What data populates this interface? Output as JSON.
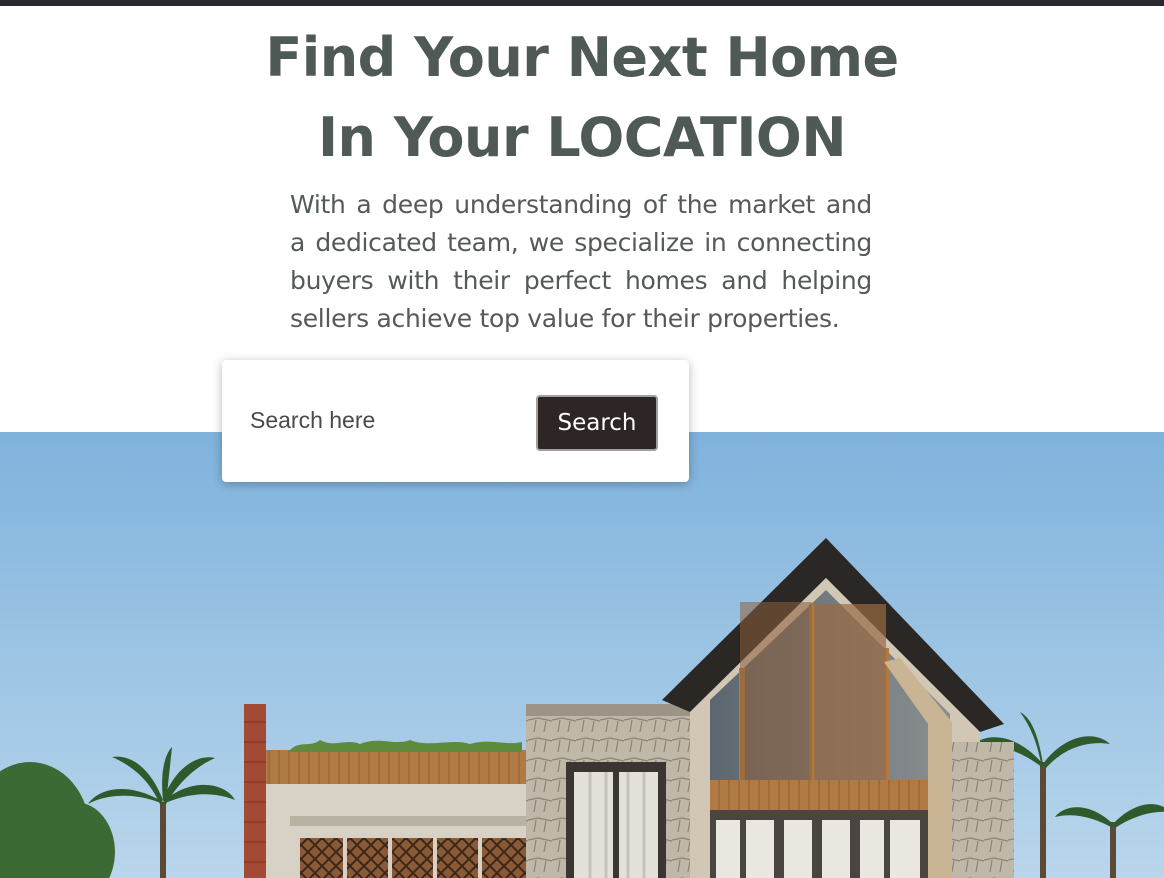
{
  "hero": {
    "title_line1": "Find Your Next Home",
    "title_line2": "In Your LOCATION",
    "description": "With a deep understanding of the market and a dedicated team, we specialize in connecting buyers with their perfect homes and helping sellers achieve top value for their properties."
  },
  "search": {
    "placeholder": "Search here",
    "button_label": "Search"
  },
  "colors": {
    "heading": "#4f5a56",
    "body_text": "#545a58",
    "button_bg": "#2d2624",
    "top_bar": "#2a2a2e",
    "sky": "#8cb9df"
  }
}
